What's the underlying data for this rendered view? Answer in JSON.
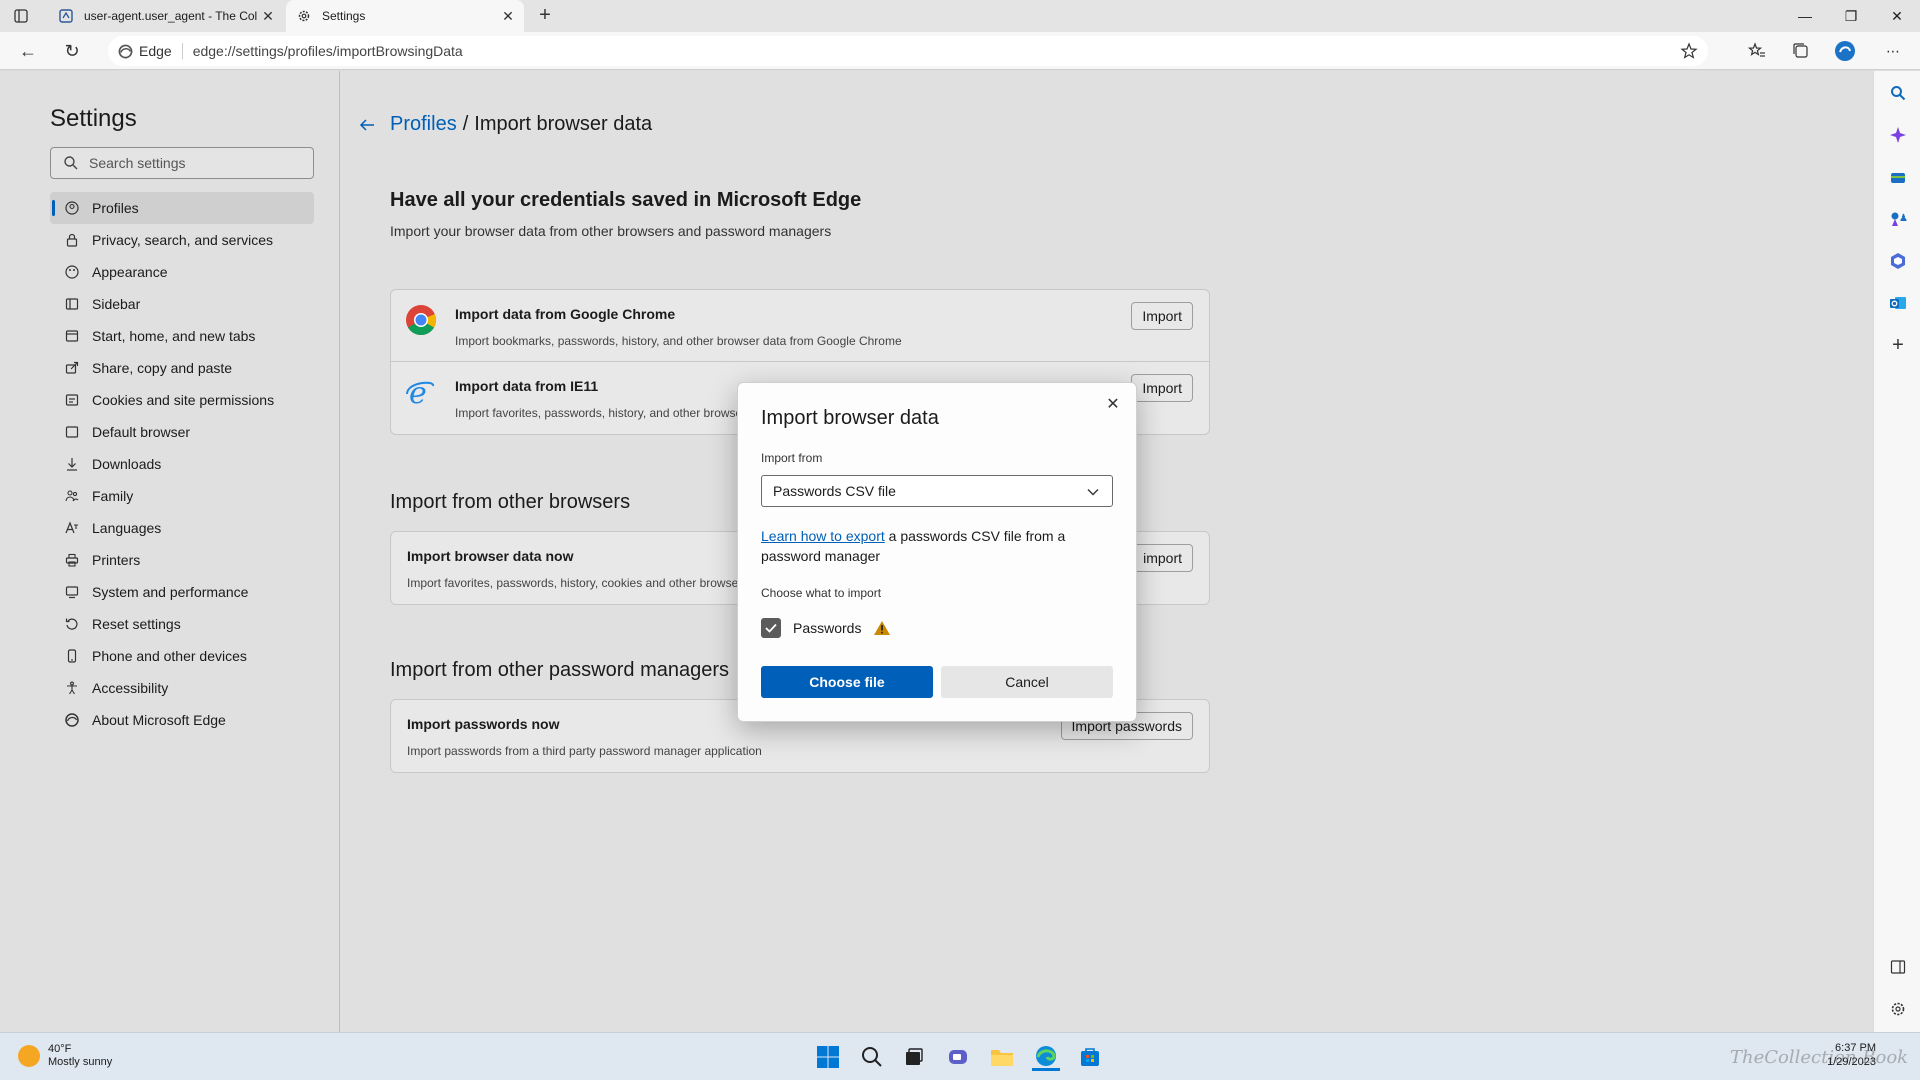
{
  "browser": {
    "tabs": [
      {
        "title": "user-agent.user_agent - The Coll",
        "icon": "document-icon"
      },
      {
        "title": "Settings",
        "icon": "gear-icon"
      }
    ],
    "address": {
      "chip": "Edge",
      "url": "edge://settings/profiles/importBrowsingData"
    }
  },
  "sidebar": {
    "title": "Settings",
    "search_placeholder": "Search settings",
    "items": [
      {
        "label": "Profiles",
        "icon": "profile-icon"
      },
      {
        "label": "Privacy, search, and services",
        "icon": "lock-icon"
      },
      {
        "label": "Appearance",
        "icon": "palette-icon"
      },
      {
        "label": "Sidebar",
        "icon": "sidebar-icon"
      },
      {
        "label": "Start, home, and new tabs",
        "icon": "home-icon"
      },
      {
        "label": "Share, copy and paste",
        "icon": "share-icon"
      },
      {
        "label": "Cookies and site permissions",
        "icon": "cookie-icon"
      },
      {
        "label": "Default browser",
        "icon": "browser-icon"
      },
      {
        "label": "Downloads",
        "icon": "download-icon"
      },
      {
        "label": "Family",
        "icon": "family-icon"
      },
      {
        "label": "Languages",
        "icon": "language-icon"
      },
      {
        "label": "Printers",
        "icon": "printer-icon"
      },
      {
        "label": "System and performance",
        "icon": "system-icon"
      },
      {
        "label": "Reset settings",
        "icon": "reset-icon"
      },
      {
        "label": "Phone and other devices",
        "icon": "phone-icon"
      },
      {
        "label": "Accessibility",
        "icon": "accessibility-icon"
      },
      {
        "label": "About Microsoft Edge",
        "icon": "edge-icon"
      }
    ]
  },
  "content": {
    "breadcrumb": {
      "parent": "Profiles",
      "separator": "/",
      "current": "Import browser data"
    },
    "heading": "Have all your credentials saved in Microsoft Edge",
    "subheading": "Import your browser data from other browsers and password managers",
    "quick_import": [
      {
        "title": "Import data from Google Chrome",
        "desc": "Import bookmarks, passwords, history, and other browser data from Google Chrome",
        "button": "Import"
      },
      {
        "title": "Import data from IE11",
        "desc": "Import favorites, passwords, history, and other browse",
        "button": "Import"
      }
    ],
    "other_browsers": {
      "heading": "Import from other browsers",
      "title": "Import browser data now",
      "desc": "Import favorites, passwords, history, cookies and other browse",
      "button": "import"
    },
    "password_managers": {
      "heading": "Import from other password managers",
      "title": "Import passwords now",
      "desc": "Import passwords from a third party password manager application",
      "button": "Import passwords"
    }
  },
  "dialog": {
    "title": "Import browser data",
    "import_from_label": "Import from",
    "selected_source": "Passwords CSV file",
    "learn_link": "Learn how to export",
    "learn_rest": " a passwords CSV file from a password manager",
    "choose_label": "Choose what to import",
    "checkbox_label": "Passwords",
    "checkbox_checked": true,
    "primary_button": "Choose file",
    "secondary_button": "Cancel"
  },
  "taskbar": {
    "weather_temp": "40°F",
    "weather_desc": "Mostly sunny",
    "time": "6:37 PM",
    "date": "1/29/2023",
    "watermark": "TheCollection Book"
  },
  "colors": {
    "accent": "#005fb8",
    "warning": "#c98a00"
  }
}
